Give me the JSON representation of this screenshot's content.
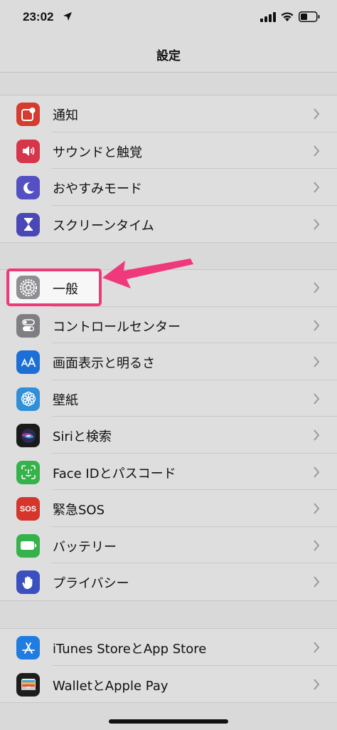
{
  "status": {
    "time": "23:02"
  },
  "nav": {
    "title": "設定"
  },
  "groups": [
    {
      "items": [
        {
          "label": "通知",
          "icon": "notifications-icon",
          "color": "#d63b2f"
        },
        {
          "label": "サウンドと触覚",
          "icon": "speaker-icon",
          "color": "#d6354a"
        },
        {
          "label": "おやすみモード",
          "icon": "moon-icon",
          "color": "#5450c4"
        },
        {
          "label": "スクリーンタイム",
          "icon": "hourglass-icon",
          "color": "#4a47b8"
        }
      ]
    },
    {
      "items": [
        {
          "label": "一般",
          "icon": "gear-icon",
          "color": "#8e8e93"
        },
        {
          "label": "コントロールセンター",
          "icon": "toggles-icon",
          "color": "#7f7f83"
        },
        {
          "label": "画面表示と明るさ",
          "icon": "text-size-icon",
          "color": "#1c6fd6"
        },
        {
          "label": "壁紙",
          "icon": "flower-icon",
          "color": "#2f8fd8"
        },
        {
          "label": "Siriと検索",
          "icon": "siri-icon",
          "color": "#1a1a1a"
        },
        {
          "label": "Face IDとパスコード",
          "icon": "face-id-icon",
          "color": "#35b34a"
        },
        {
          "label": "緊急SOS",
          "icon": "sos-icon",
          "color": "#d6352b"
        },
        {
          "label": "バッテリー",
          "icon": "battery-icon",
          "color": "#35b34a"
        },
        {
          "label": "プライバシー",
          "icon": "hand-icon",
          "color": "#3a4fc0"
        }
      ]
    },
    {
      "items": [
        {
          "label": "iTunes StoreとApp Store",
          "icon": "app-store-icon",
          "color": "#1f7ce0"
        },
        {
          "label": "WalletとApple Pay",
          "icon": "wallet-icon",
          "color": "#1d1d1d"
        }
      ]
    }
  ],
  "sos_text": "SOS",
  "accent_annotation_color": "#f0397a"
}
